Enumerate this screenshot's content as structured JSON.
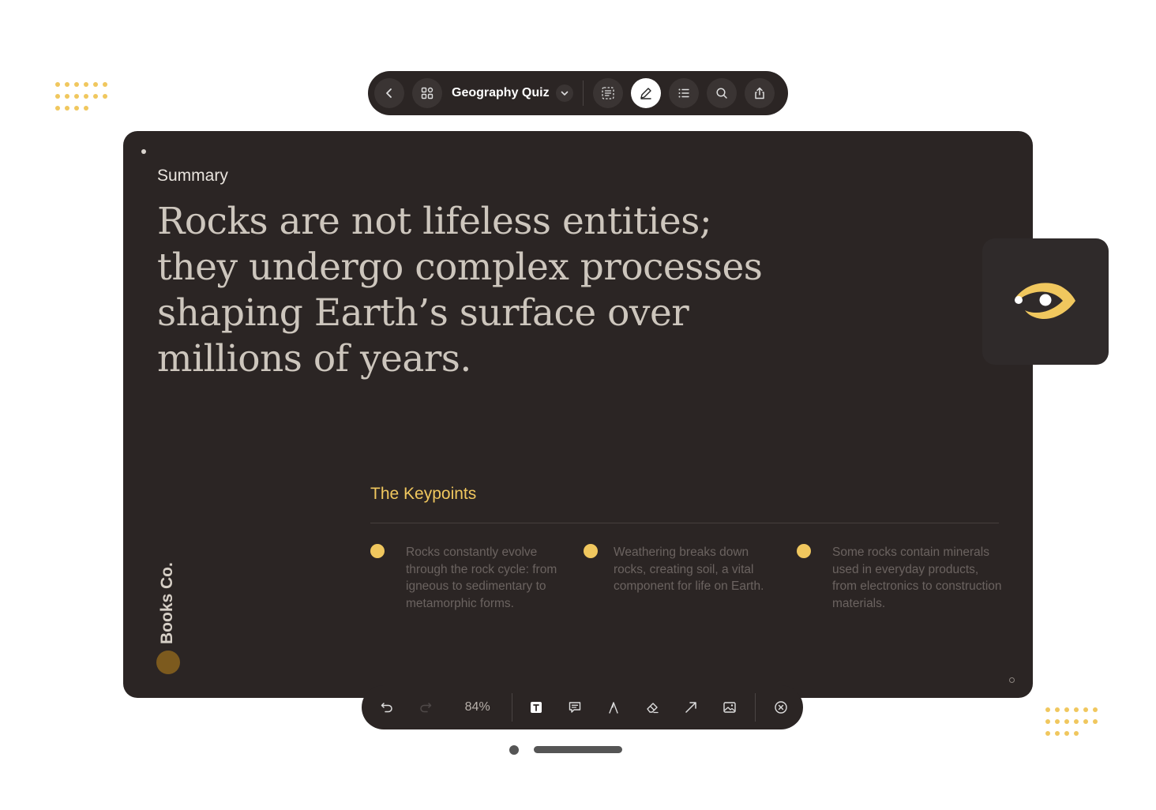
{
  "toolbar": {
    "title": "Geography Quiz",
    "buttons": [
      "back-icon",
      "grid-icon",
      "chevron-down-icon",
      "select-text-icon",
      "pen-icon",
      "list-icon",
      "search-icon",
      "share-icon"
    ]
  },
  "slide": {
    "section_label": "Summary",
    "headline": "Rocks are not lifeless entities; they undergo complex processes shaping Earth’s surface over millions of years.",
    "brand": "Books Co.",
    "keypoints_title": "The Keypoints",
    "keypoints": [
      {
        "text": "Rocks constantly evolve through the rock cycle: from igneous to sedimentary to metamorphic forms."
      },
      {
        "text": "Weathering breaks down rocks, creating soil, a vital component for life on Earth."
      },
      {
        "text": "Some rocks contain minerals used in everyday products, from electronics to construction materials."
      }
    ]
  },
  "editbar": {
    "zoom": "84%",
    "tools": [
      "undo-icon",
      "redo-icon",
      "text-tool-icon",
      "comment-icon",
      "pen-tool-icon",
      "eraser-icon",
      "arrow-icon",
      "image-icon",
      "close-icon"
    ]
  },
  "colors": {
    "accent": "#f0c75e",
    "card": "#2b2524",
    "brand_circle": "#7c5a1e"
  },
  "pager": {
    "current": 1,
    "total": 2
  }
}
